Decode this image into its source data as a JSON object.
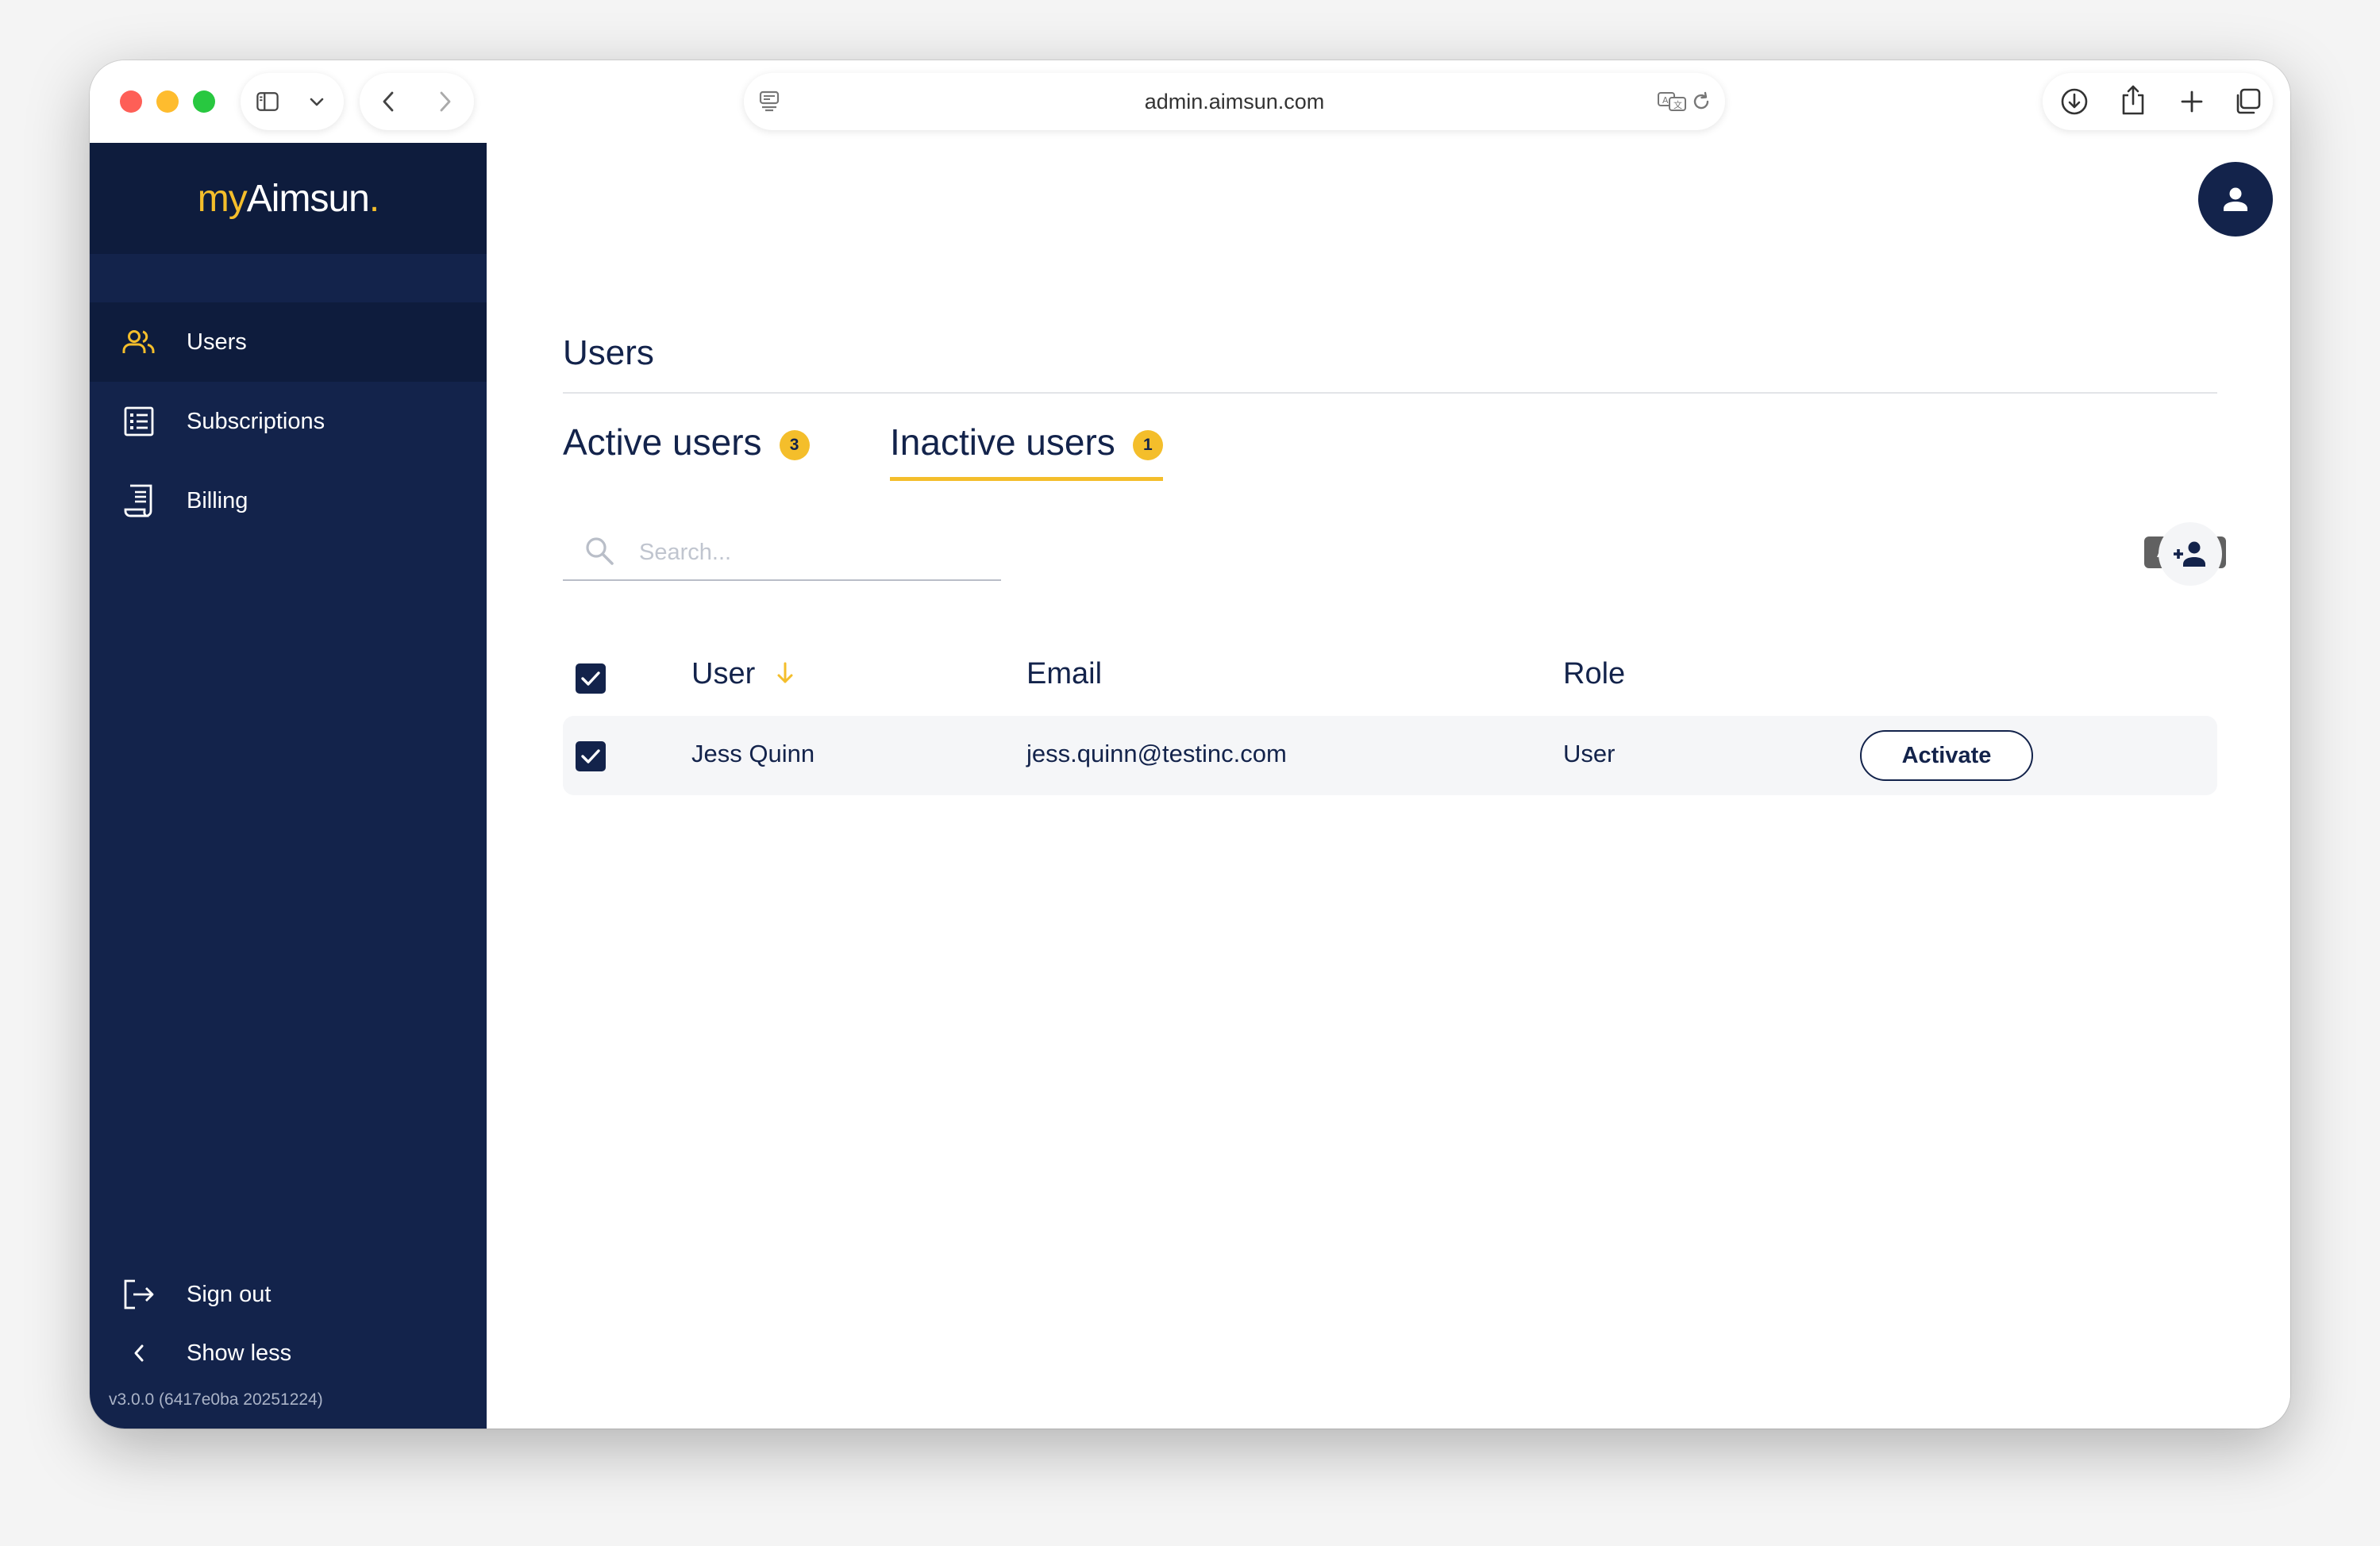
{
  "browser": {
    "url": "admin.aimsun.com"
  },
  "brand": {
    "logo_prefix": "my",
    "logo_main": "Aimsun",
    "logo_dot": ".",
    "accent_color": "#f4be2b",
    "navy_color": "#13234b"
  },
  "sidebar": {
    "items": [
      {
        "label": "Users",
        "icon": "users-icon",
        "active": true
      },
      {
        "label": "Subscriptions",
        "icon": "list-icon",
        "active": false
      },
      {
        "label": "Billing",
        "icon": "receipt-icon",
        "active": false
      }
    ],
    "footer": [
      {
        "label": "Sign out",
        "icon": "sign-out-icon"
      },
      {
        "label": "Show less",
        "icon": "chevron-left-icon"
      }
    ],
    "version": "v3.0.0 (6417e0ba 20251224)"
  },
  "main": {
    "title": "Users",
    "tabs": [
      {
        "label": "Active users",
        "count": "3",
        "active": false
      },
      {
        "label": "Inactive users",
        "count": "1",
        "active": true
      }
    ],
    "search": {
      "placeholder": "Search...",
      "value": ""
    },
    "toolbar": {
      "tooltip": "Activate"
    },
    "table": {
      "headers": {
        "user": "User",
        "email": "Email",
        "role": "Role"
      },
      "sort": {
        "column": "User",
        "direction": "descending"
      },
      "select_all_checked": true,
      "rows": [
        {
          "checked": true,
          "user": "Jess Quinn",
          "email": "jess.quinn@testinc.com",
          "role": "User",
          "action": "Activate"
        }
      ]
    }
  }
}
